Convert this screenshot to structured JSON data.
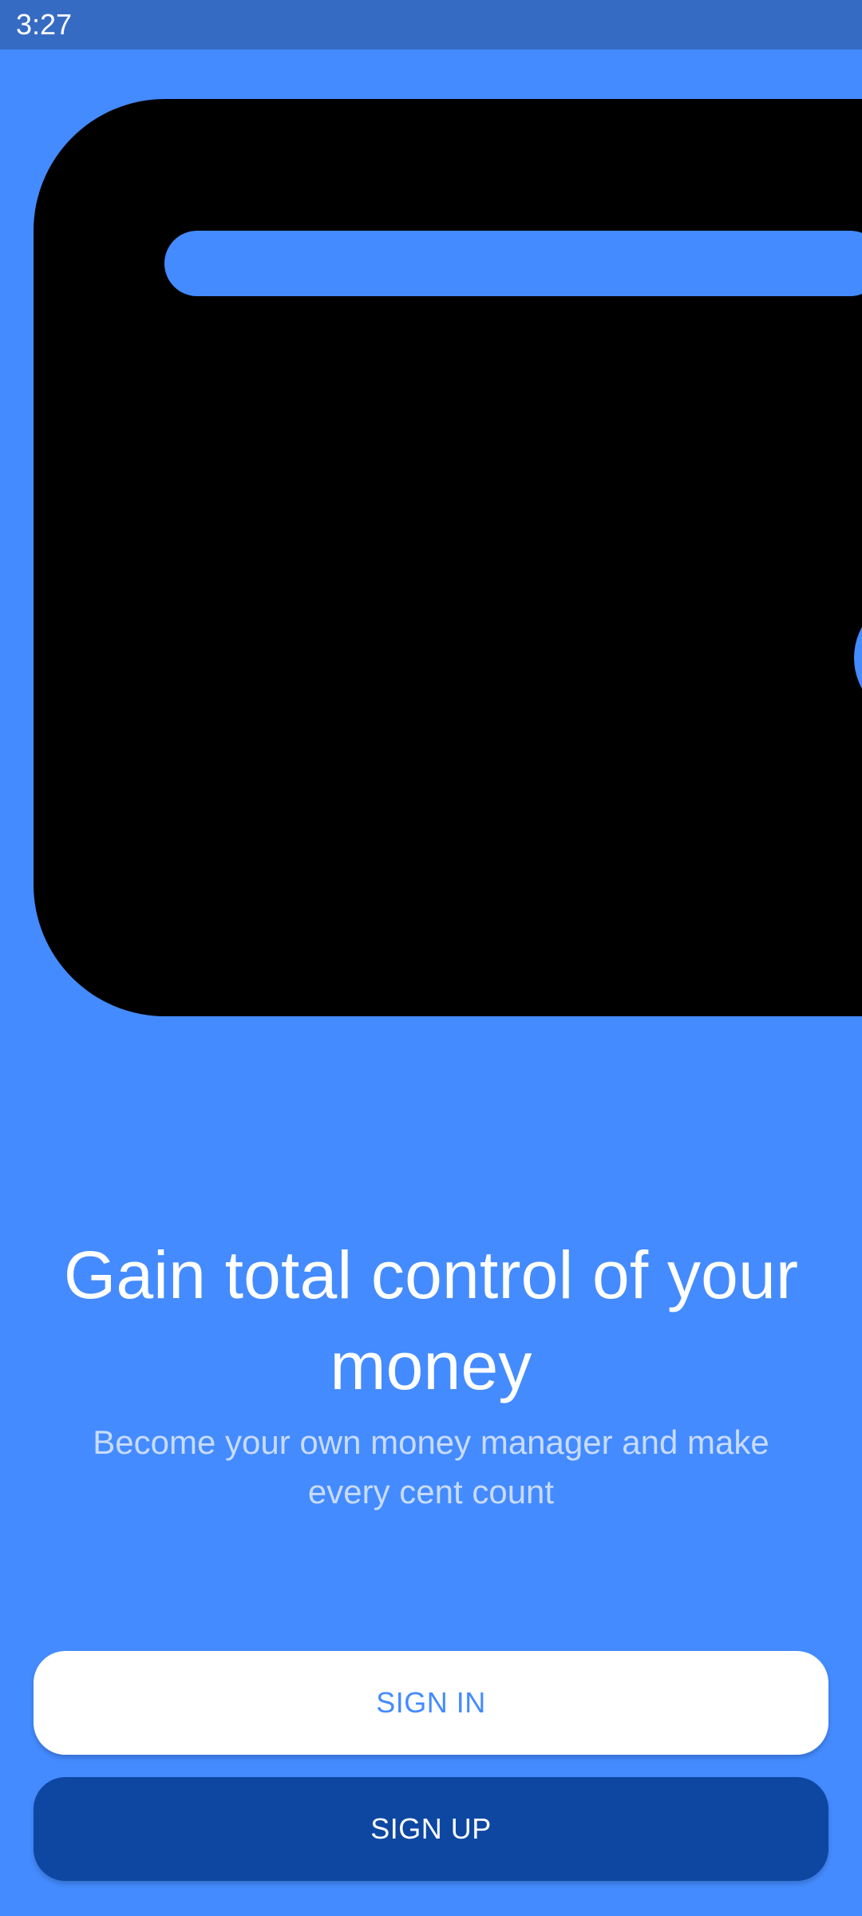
{
  "status_bar": {
    "time": "3:27"
  },
  "illustration": {
    "icon": "wallet-icon",
    "colors": {
      "body": "#000000",
      "cutout": "#448BFF"
    }
  },
  "onboarding": {
    "headline": "Gain total control of your money",
    "subline": "Become your own money manager and make every cent count"
  },
  "actions": {
    "sign_in_label": "SIGN IN",
    "sign_up_label": "SIGN UP"
  },
  "colors": {
    "background": "#448BFF",
    "status_bar": "#366BC4",
    "primary_dark": "#0D47A1",
    "subtitle": "#C8DBFF",
    "white": "#FFFFFF"
  }
}
